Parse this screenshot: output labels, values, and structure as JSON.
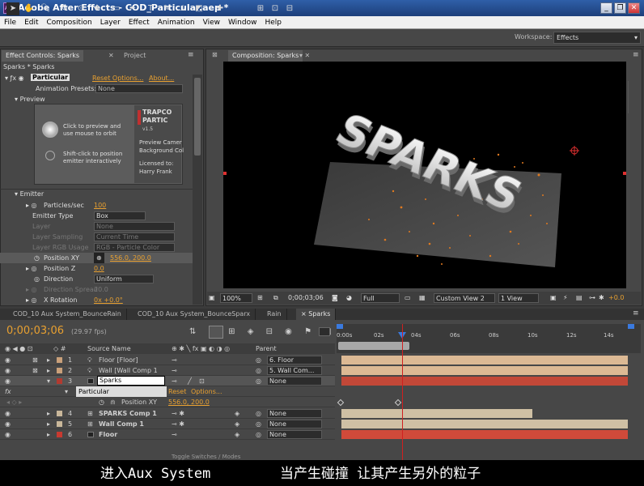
{
  "title": "Adobe After Effects - COD_Particular.aep *",
  "window_buttons": [
    "_",
    "❐",
    "✕"
  ],
  "menu": [
    "File",
    "Edit",
    "Composition",
    "Layer",
    "Effect",
    "Animation",
    "View",
    "Window",
    "Help"
  ],
  "workspace": {
    "label": "Workspace:",
    "value": "Effects"
  },
  "effect_controls": {
    "tab": "Effect Controls: Sparks",
    "project_tab": "Project",
    "header": "Sparks * Sparks",
    "effect_name": "Particular",
    "reset": "Reset Options...",
    "about": "About...",
    "animation_presets_label": "Animation Presets:",
    "animation_presets_value": "None",
    "preview_label": "Preview",
    "preview_hint1": "Click to preview and use mouse to orbit",
    "preview_hint2": "Shift-click to position emitter interactively",
    "trapcode_brand": "TRAPCO PARTIC",
    "trapcode_version": "v1.5",
    "trapcode_lines": [
      "Preview Camer",
      "Background Col",
      "",
      "Licensed to:",
      "Harry Frank"
    ],
    "emitter_label": "Emitter",
    "rows": [
      {
        "label": "Particles/sec",
        "value": "100",
        "kind": "value"
      },
      {
        "label": "Emitter Type",
        "value": "Box",
        "kind": "select"
      },
      {
        "label": "Layer",
        "value": "None",
        "kind": "select-dim"
      },
      {
        "label": "Layer Sampling",
        "value": "Current Time",
        "kind": "select-dim"
      },
      {
        "label": "Layer RGB Usage",
        "value": "RGB - Particle Color",
        "kind": "select-dim"
      },
      {
        "label": "Position XY",
        "value": "556.0, 200.0",
        "kind": "value"
      },
      {
        "label": "Position Z",
        "value": "0.0",
        "kind": "value"
      },
      {
        "label": "Direction",
        "value": "Uniform",
        "kind": "select"
      },
      {
        "label": "Direction Spread",
        "value": "20.0",
        "kind": "value-dim"
      },
      {
        "label": "X Rotation",
        "value": "0x +0.0°",
        "kind": "value"
      }
    ]
  },
  "composition": {
    "tab": "Composition: Sparks",
    "text": "SPARKS",
    "footer": {
      "zoom": "100%",
      "time": "0;00;03;06",
      "resolution": "Full",
      "view": "Custom View 2",
      "views": "1 View",
      "exposure": "+0.0"
    }
  },
  "timeline_tabs": [
    "COD_10 Aux System_BounceRain",
    "COD_10 Aux System_BounceSparx",
    "Rain",
    "Sparks"
  ],
  "timeline": {
    "timecode": "0;00;03;06",
    "fps": "(29.97 fps)",
    "col_source": "Source Name",
    "col_parent": "Parent",
    "ticks": [
      "0:00s",
      "02s",
      "04s",
      "06s",
      "08s",
      "10s",
      "12s",
      "14s"
    ],
    "layers": [
      {
        "num": "1",
        "name": "Floor [Floor]",
        "parent": "6. Floor",
        "color": "#c9a07a"
      },
      {
        "num": "2",
        "name": "Wall [Wall Comp 1",
        "parent": "5. Wall Com...",
        "color": "#c9a07a"
      },
      {
        "num": "3",
        "name": "Sparks",
        "parent": "None",
        "color": "#b23a30"
      },
      {
        "num": "4",
        "name": "SPARKS Comp 1",
        "parent": "None",
        "color": "#c9b79a"
      },
      {
        "num": "5",
        "name": "Wall Comp 1",
        "parent": "None",
        "color": "#c9b79a"
      },
      {
        "num": "6",
        "name": "Floor",
        "parent": "None",
        "color": "#c83a30"
      }
    ],
    "sub_effect": "Particular",
    "sub_reset": "Reset",
    "sub_options": "Options...",
    "sub_prop": "Position XY",
    "sub_value": "556.0, 200.0",
    "toggle_label": "Toggle Switches / Modes"
  },
  "subtitle": {
    "left": "进入Aux System",
    "right": "当产生碰撞 让其产生另外的粒子"
  }
}
